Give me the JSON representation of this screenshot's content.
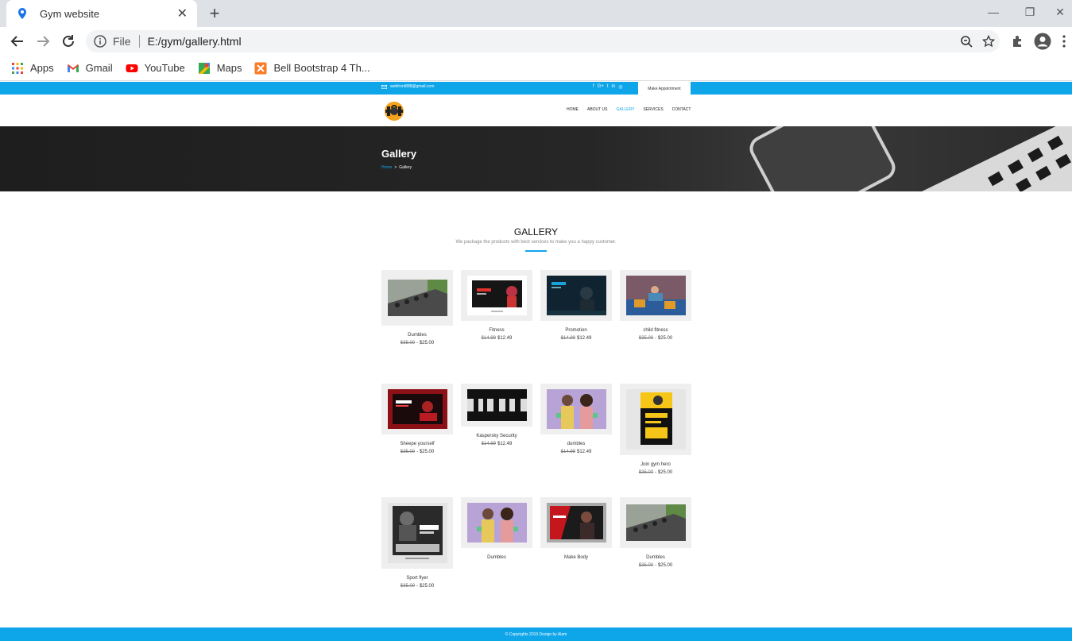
{
  "browser": {
    "tab_title": "Gym website",
    "url_scheme": "File",
    "url": "E:/gym/gallery.html",
    "bookmarks": [
      "Apps",
      "Gmail",
      "YouTube",
      "Maps",
      "Bell Bootstrap 4 Th..."
    ]
  },
  "site": {
    "email": "webfront888@gmail.com",
    "social": [
      "f",
      "G+",
      "t",
      "in",
      "◎"
    ],
    "appointment": "Make Appointment",
    "menu": [
      "HOME",
      "ABOUT US",
      "GALLERY",
      "SERVICES",
      "CONTACT"
    ],
    "active_menu": "GALLERY",
    "accent_color": "#0ea5e9"
  },
  "hero": {
    "title": "Gallery",
    "crumb_home": "Home",
    "crumb_sep": ">",
    "crumb_current": "Gallery"
  },
  "gallery": {
    "title": "GALLERY",
    "subtitle": "We package the products with best services to make you a happy customer.",
    "items": [
      {
        "name": "Dumbles",
        "old_price": "$35.00",
        "price": "- $25.00",
        "img": "gym-dumbbells"
      },
      {
        "name": "Fitness",
        "old_price": "$14.99",
        "price": "$12.49",
        "img": "fitness-banner"
      },
      {
        "name": "Promotion",
        "old_price": "$14.99",
        "price": "$12.49",
        "img": "promotion-banner"
      },
      {
        "name": "child fitness",
        "old_price": "$35.00",
        "price": "- $25.00",
        "img": "child-fitness"
      },
      {
        "name": "Sheepe yourself",
        "old_price": "$35.00",
        "price": "- $25.00",
        "img": "shape-yourself"
      },
      {
        "name": "Kaspersky Security",
        "old_price": "$14.99",
        "price": "$12.49",
        "img": "gym-silhouette"
      },
      {
        "name": "dumbles",
        "old_price": "$14.99",
        "price": "$12.49",
        "img": "dumbbell-kids"
      },
      {
        "name": "Join gym hero",
        "old_price": "$35.00",
        "price": "- $25.00",
        "img": "gym-hero-flyer"
      },
      {
        "name": "Sport flyer",
        "old_price": "$35.00",
        "price": "- $25.00",
        "img": "fitness-flyer"
      },
      {
        "name": "Dumbles",
        "old_price": "",
        "price": "",
        "img": "dumbbell-kids"
      },
      {
        "name": "Make Body",
        "old_price": "",
        "price": "",
        "img": "make-body-banner"
      },
      {
        "name": "Dumbles",
        "old_price": "$35.00",
        "price": "- $25.00",
        "img": "gym-dumbbells"
      }
    ]
  },
  "footer": {
    "text": "© Copyrights 2019 Design by Alam"
  }
}
